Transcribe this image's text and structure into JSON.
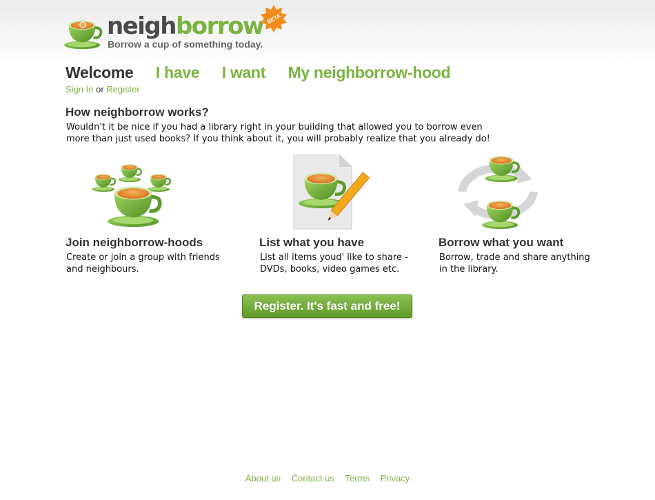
{
  "header": {
    "logo_part1": "neigh",
    "logo_part2": "borrow",
    "tagline": "Borrow a cup of something today.",
    "badge": "BETA"
  },
  "nav": {
    "items": [
      {
        "label": "Welcome",
        "active": true
      },
      {
        "label": "I have",
        "active": false
      },
      {
        "label": "I want",
        "active": false
      },
      {
        "label": "My neighborrow-hood",
        "active": false
      }
    ],
    "sign_in": "Sign In",
    "or": "or",
    "register": "Register"
  },
  "intro": {
    "title": "How neighborrow works?",
    "text": "Wouldn't it be nice if you had a library right in your building that allowed you to borrow even more than just used books? If you think about it, you will probably realize that you already do!"
  },
  "features": [
    {
      "title": "Join neighborrow-hoods",
      "text": "Create or join a group with friends and neighbours.",
      "icon": "cups-group-icon"
    },
    {
      "title": "List what you have",
      "text": "List all items youd' like to share - DVDs, books, video games etc.",
      "icon": "cup-document-pencil-icon"
    },
    {
      "title": "Borrow what you want",
      "text": "Borrow, trade and share anything in the library.",
      "icon": "cups-exchange-icon"
    }
  ],
  "cta": {
    "label": "Register. It's fast and free!"
  },
  "footer": {
    "links": [
      "About us",
      "Contact us",
      "Terms",
      "Privacy"
    ]
  },
  "colors": {
    "brand_green": "#7ab33e",
    "dark_text": "#333333",
    "cup_green": "#74b53c",
    "tea_orange": "#e8862a",
    "badge_orange": "#f28b1c"
  }
}
